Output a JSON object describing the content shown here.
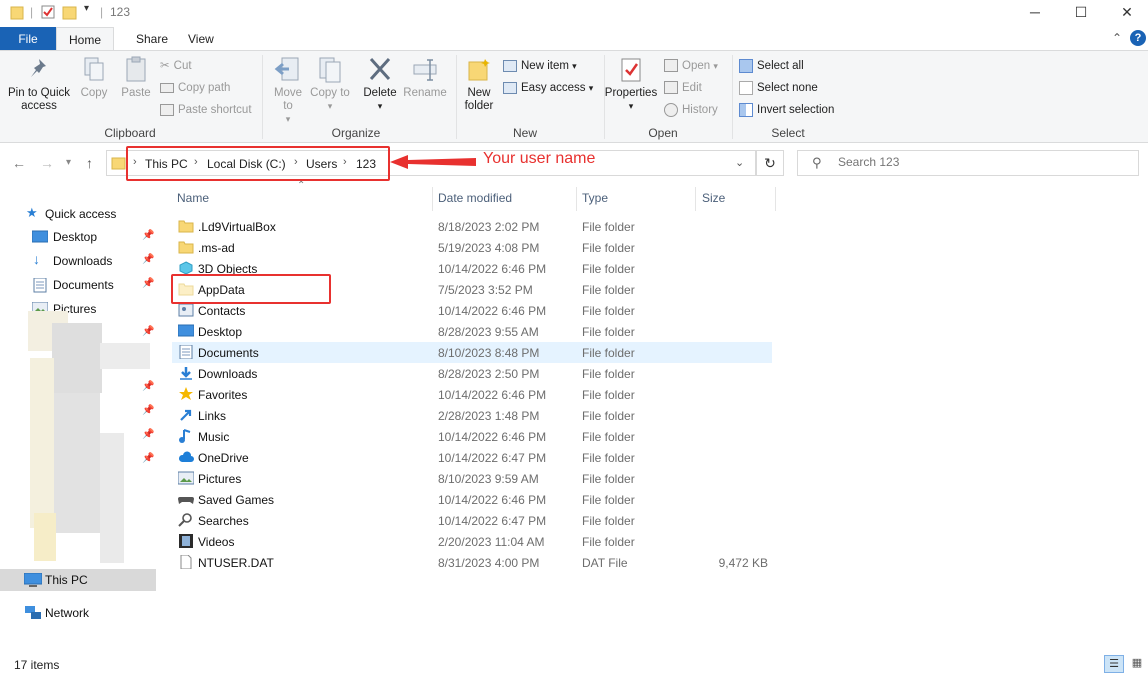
{
  "window": {
    "title": "123"
  },
  "tabs": {
    "file": "File",
    "home": "Home",
    "share": "Share",
    "view": "View"
  },
  "ribbon": {
    "clipboard": {
      "label": "Clipboard",
      "pin": "Pin to Quick access",
      "copy": "Copy",
      "paste": "Paste",
      "cut": "Cut",
      "copy_path": "Copy path",
      "paste_shortcut": "Paste shortcut"
    },
    "organize": {
      "label": "Organize",
      "move_to": "Move to",
      "copy_to": "Copy to",
      "delete": "Delete",
      "rename": "Rename"
    },
    "new": {
      "label": "New",
      "new_folder": "New folder",
      "new_item": "New item",
      "easy_access": "Easy access"
    },
    "open": {
      "label": "Open",
      "properties": "Properties",
      "open": "Open",
      "edit": "Edit",
      "history": "History"
    },
    "select": {
      "label": "Select",
      "select_all": "Select all",
      "select_none": "Select none",
      "invert": "Invert selection"
    }
  },
  "address": {
    "crumbs": [
      "This PC",
      "Local Disk (C:)",
      "Users",
      "123"
    ],
    "search_placeholder": "Search 123"
  },
  "annotation": {
    "text": "Your user name"
  },
  "nav": {
    "quick_access": "Quick access",
    "desktop": "Desktop",
    "downloads": "Downloads",
    "documents": "Documents",
    "pictures": "Pictures",
    "this_pc": "This PC",
    "network": "Network"
  },
  "columns": {
    "name": "Name",
    "date": "Date modified",
    "type": "Type",
    "size": "Size"
  },
  "files": [
    {
      "name": ".Ld9VirtualBox",
      "date": "8/18/2023 2:02 PM",
      "type": "File folder",
      "size": "",
      "icon": "folder-icon"
    },
    {
      "name": ".ms-ad",
      "date": "5/19/2023 4:08 PM",
      "type": "File folder",
      "size": "",
      "icon": "folder-icon"
    },
    {
      "name": "3D Objects",
      "date": "10/14/2022 6:46 PM",
      "type": "File folder",
      "size": "",
      "icon": "cube-icon"
    },
    {
      "name": "AppData",
      "date": "7/5/2023 3:52 PM",
      "type": "File folder",
      "size": "",
      "icon": "folder-hidden-icon"
    },
    {
      "name": "Contacts",
      "date": "10/14/2022 6:46 PM",
      "type": "File folder",
      "size": "",
      "icon": "contacts-icon"
    },
    {
      "name": "Desktop",
      "date": "8/28/2023 9:55 AM",
      "type": "File folder",
      "size": "",
      "icon": "desktop-icon"
    },
    {
      "name": "Documents",
      "date": "8/10/2023 8:48 PM",
      "type": "File folder",
      "size": "",
      "icon": "documents-icon"
    },
    {
      "name": "Downloads",
      "date": "8/28/2023 2:50 PM",
      "type": "File folder",
      "size": "",
      "icon": "download-icon"
    },
    {
      "name": "Favorites",
      "date": "10/14/2022 6:46 PM",
      "type": "File folder",
      "size": "",
      "icon": "star-icon"
    },
    {
      "name": "Links",
      "date": "2/28/2023 1:48 PM",
      "type": "File folder",
      "size": "",
      "icon": "link-icon"
    },
    {
      "name": "Music",
      "date": "10/14/2022 6:46 PM",
      "type": "File folder",
      "size": "",
      "icon": "music-icon"
    },
    {
      "name": "OneDrive",
      "date": "10/14/2022 6:47 PM",
      "type": "File folder",
      "size": "",
      "icon": "cloud-icon"
    },
    {
      "name": "Pictures",
      "date": "8/10/2023 9:59 AM",
      "type": "File folder",
      "size": "",
      "icon": "pictures-icon"
    },
    {
      "name": "Saved Games",
      "date": "10/14/2022 6:46 PM",
      "type": "File folder",
      "size": "",
      "icon": "gamepad-icon"
    },
    {
      "name": "Searches",
      "date": "10/14/2022 6:47 PM",
      "type": "File folder",
      "size": "",
      "icon": "search-icon"
    },
    {
      "name": "Videos",
      "date": "2/20/2023 11:04 AM",
      "type": "File folder",
      "size": "",
      "icon": "video-icon"
    },
    {
      "name": "NTUSER.DAT",
      "date": "8/31/2023 4:00 PM",
      "type": "DAT File",
      "size": "9,472 KB",
      "icon": "file-icon"
    }
  ],
  "status": {
    "items": "17 items"
  },
  "colors": {
    "accent": "#1a63b5",
    "annotation": "#e8312f",
    "highlight": "#e5f3ff",
    "folder": "#f8d775"
  }
}
